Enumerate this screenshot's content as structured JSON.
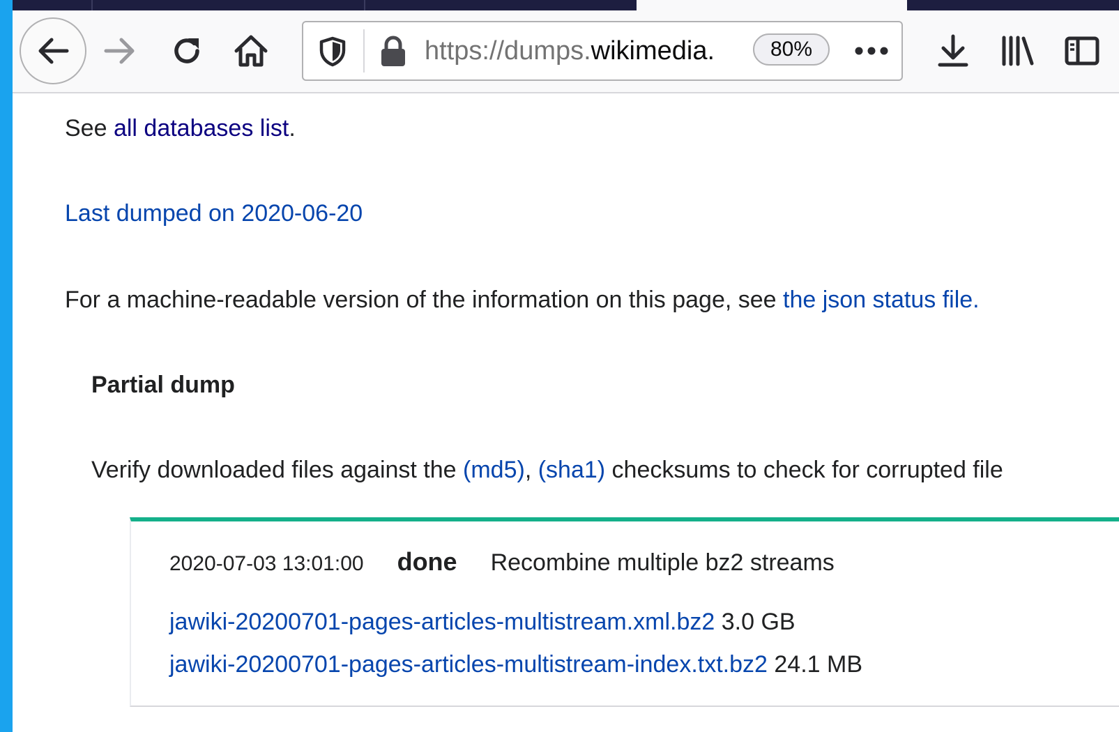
{
  "browser": {
    "url_scheme": "https://dumps.",
    "url_domain": "wikimedia.",
    "zoom": "80%",
    "overflow_label": "•••",
    "icons": {
      "back": "back-arrow-icon",
      "forward": "forward-arrow-icon",
      "reload": "reload-icon",
      "home": "home-icon",
      "tracking": "shield-icon",
      "lock": "lock-icon",
      "downloads": "download-icon",
      "library": "library-icon",
      "sidebar": "sidebar-icon"
    }
  },
  "content": {
    "see_prefix": "See ",
    "all_databases_link": "all databases list",
    "see_suffix": ".",
    "last_dumped": "Last dumped on 2020-06-20",
    "machine_readable_prefix": "For a machine-readable version of the information on this page, see ",
    "json_status_link": "the json status file.",
    "partial_dump_heading": "Partial dump",
    "verify_prefix": "Verify downloaded files against the ",
    "md5_link": "(md5)",
    "verify_comma": ", ",
    "sha1_link": "(sha1)",
    "verify_suffix": " checksums to check for corrupted file",
    "status": {
      "timestamp": "2020-07-03 13:01:00",
      "state": "done",
      "description": "Recombine multiple bz2 streams",
      "files": [
        {
          "name": "jawiki-20200701-pages-articles-multistream.xml.bz2",
          "size": "3.0 GB"
        },
        {
          "name": "jawiki-20200701-pages-articles-multistream-index.txt.bz2",
          "size": "24.1 MB"
        }
      ]
    }
  },
  "colors": {
    "link": "#0645ad",
    "visited_link": "#0b0080",
    "status_done_bar": "#14b08a",
    "tab_strip": "#1d1e40",
    "desktop": "#1aa3ee"
  }
}
